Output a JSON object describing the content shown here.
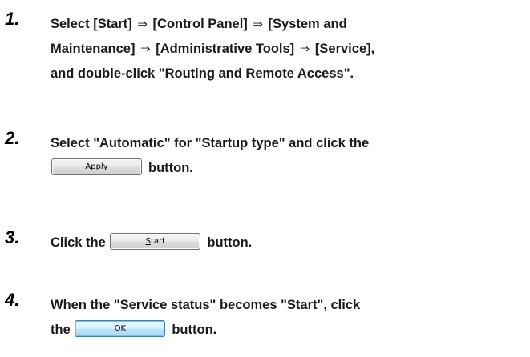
{
  "steps": [
    {
      "number": "1.",
      "lines": [
        [
          "Select [Start] ",
          "⇒",
          " [Control Panel] ",
          "⇒",
          " [System and"
        ],
        [
          "Maintenance] ",
          "⇒",
          " [Administrative Tools] ",
          "⇒",
          " [Service],"
        ],
        [
          "and double-click \"Routing and Remote Access\"."
        ]
      ]
    },
    {
      "number": "2.",
      "line1": "Select \"Automatic\" for \"Startup type\" and click the",
      "button_accel": "A",
      "button_rest": "pply",
      "after_button": "button."
    },
    {
      "number": "3.",
      "before_button": "Click the",
      "button_accel": "S",
      "button_rest": "tart",
      "after_button": "button."
    },
    {
      "number": "4.",
      "line1": "When the \"Service status\" becomes \"Start\", click",
      "before_button": "the",
      "button_label": "OK",
      "after_button": "button."
    }
  ]
}
